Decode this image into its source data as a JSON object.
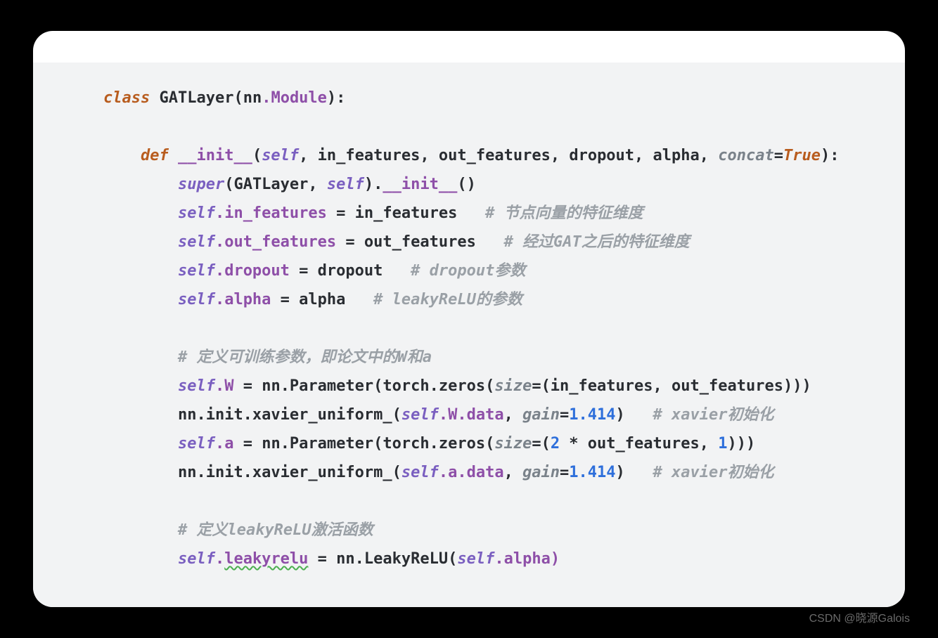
{
  "watermark": "CSDN @晓源Galois",
  "code": {
    "l1": {
      "kw1": "class ",
      "name": "GATLayer",
      "p1": "(nn",
      "attr": ".Module",
      "p2": "):"
    },
    "l3": {
      "kw": "def ",
      "fn": "__init__",
      "p1": "(",
      "self": "self",
      "c1": ", ",
      "a1": "in_features",
      "c2": ", ",
      "a2": "out_features",
      "c3": ", ",
      "a3": "dropout",
      "c4": ", ",
      "a4": "alpha",
      "c5": ", ",
      "named": "concat",
      "eq": "=",
      "val": "True",
      "p2": "):"
    },
    "l4": {
      "sup": "super",
      "p1": "(GATLayer",
      "c1": ", ",
      "self": "self",
      "p2": ").",
      "init": "__init__",
      "p3": "()"
    },
    "l5": {
      "self": "self",
      "attr": ".in_features ",
      "eq": "=",
      "rhs": " in_features   ",
      "comment": "# 节点向量的特征维度"
    },
    "l6": {
      "self": "self",
      "attr": ".out_features ",
      "eq": "=",
      "rhs": " out_features   ",
      "comment": "# 经过GAT之后的特征维度"
    },
    "l7": {
      "self": "self",
      "attr": ".dropout ",
      "eq": "=",
      "rhs": " dropout   ",
      "comment": "# dropout参数"
    },
    "l8": {
      "self": "self",
      "attr": ".alpha ",
      "eq": "=",
      "rhs": " alpha   ",
      "comment": "# leakyReLU的参数"
    },
    "l10": {
      "comment": "# 定义可训练参数，即论文中的W和a"
    },
    "l11": {
      "self": "self",
      "attr": ".W ",
      "eq": "=",
      "rhs1": " nn.Parameter(torch.zeros(",
      "named": "size",
      "eq2": "=",
      "rhs2": "(in_features",
      "c1": ", ",
      "rhs3": "out_features)))"
    },
    "l12": {
      "pre": "nn.init.xavier_uniform_(",
      "self": "self",
      "attr": ".W.data",
      "c1": ", ",
      "named": "gain",
      "eq": "=",
      "num": "1.414",
      "p": ")   ",
      "comment": "# xavier初始化"
    },
    "l13": {
      "self": "self",
      "attr": ".a ",
      "eq": "=",
      "rhs1": " nn.Parameter(torch.zeros(",
      "named": "size",
      "eq2": "=",
      "p1": "(",
      "num": "2",
      "rhs2": " * out_features",
      "c1": ", ",
      "num2": "1",
      "p2": ")))"
    },
    "l14": {
      "pre": "nn.init.xavier_uniform_(",
      "self": "self",
      "attr": ".a.data",
      "c1": ", ",
      "named": "gain",
      "eq": "=",
      "num": "1.414",
      "p": ")   ",
      "comment": "# xavier初始化"
    },
    "l16": {
      "comment": "# 定义leakyReLU激活函数"
    },
    "l17": {
      "self": "self",
      "attr1": ".",
      "sq": "leakyrelu",
      "eq": " = ",
      "rhs": "nn.LeakyReLU(",
      "self2": "self",
      "attr2": ".alpha)"
    }
  }
}
